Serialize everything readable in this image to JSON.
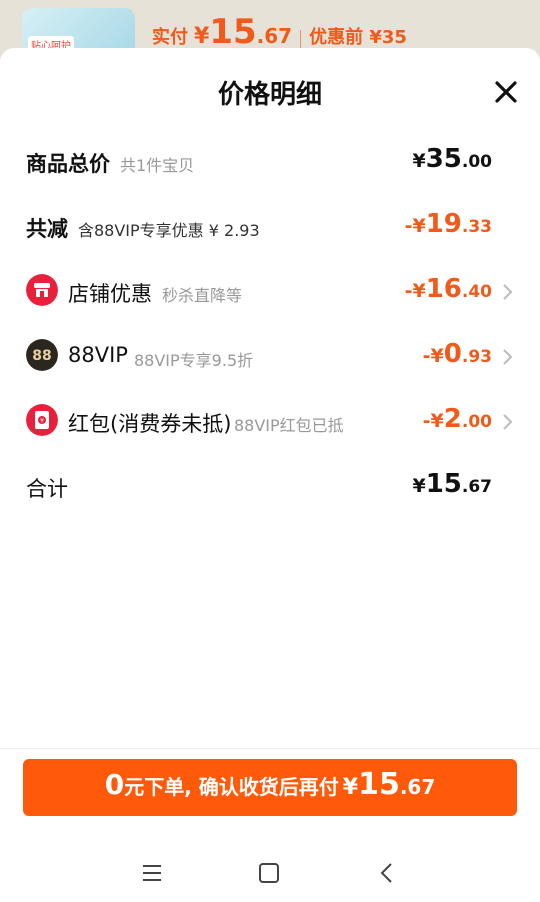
{
  "background": {
    "thumb_tag": "贴心呵护",
    "paid_label": "实付",
    "paid_yen": "¥",
    "paid_int": "15",
    "paid_dec": ".67",
    "before_label": "优惠前 ¥35"
  },
  "sheet": {
    "title": "价格明细"
  },
  "rows": [
    {
      "name": "商品总价",
      "sub": "共1件宝贝",
      "yen": "¥",
      "int": "35",
      "dec": ".00"
    },
    {
      "name": "共减",
      "sub": "含88VIP专享优惠 ¥ 2.93",
      "yen": "-¥",
      "int": "19",
      "dec": ".33"
    },
    {
      "name": "店铺优惠",
      "sub": "秒杀直降等",
      "yen": "-¥",
      "int": "16",
      "dec": ".40"
    },
    {
      "name": "88VIP",
      "sub": "88VIP专享9.5折",
      "yen": "-¥",
      "int": "0",
      "dec": ".93"
    },
    {
      "name": "红包(消费券未抵)",
      "sub": "88VIP红包已抵",
      "yen": "-¥",
      "int": "2",
      "dec": ".00"
    },
    {
      "name": "合计",
      "sub": "",
      "yen": "¥",
      "int": "15",
      "dec": ".67"
    }
  ],
  "cta": {
    "zero": "0",
    "text": "元下单, 确认收货后再付",
    "yen": "¥",
    "int": "15",
    "dec": ".67"
  },
  "colors": {
    "accent": "#ff5a0a",
    "discount": "#f05a1a"
  },
  "icons": [
    "close-icon",
    "shop-icon",
    "vip88-icon",
    "redpacket-icon",
    "chevron-right-icon",
    "menu-icon",
    "home-icon",
    "back-icon"
  ]
}
